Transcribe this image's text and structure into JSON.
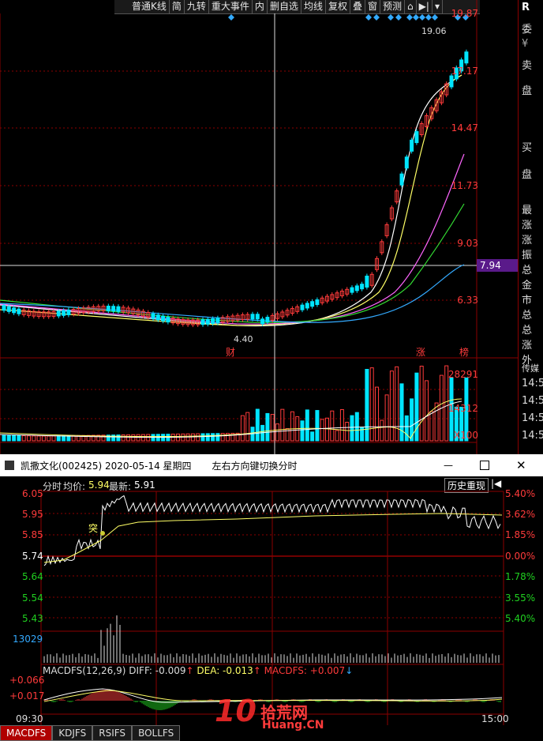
{
  "toolbar": {
    "items": [
      "普通K线",
      "简",
      "九转",
      "重大事件",
      "内",
      "删自选",
      "均线",
      "复权",
      "叠",
      "窗",
      "预测"
    ],
    "icons": [
      "home-icon",
      "export-icon",
      "dropdown-icon"
    ]
  },
  "kline": {
    "price_labels": [
      "19.87",
      "17.17",
      "14.47",
      "11.73",
      "9.03",
      "7.94",
      "6.33"
    ],
    "current_price": "7.94",
    "high_label": "19.06",
    "low_label": "4.40",
    "events": [
      "财",
      "涨",
      "榜"
    ],
    "volume_labels": [
      "28291",
      "14312",
      "X100"
    ]
  },
  "side_panel": {
    "header": "R",
    "lines": [
      "委",
      "¥",
      "卖",
      "盘",
      "",
      "买",
      "盘",
      "最",
      "涨",
      "涨",
      "振",
      "总",
      "金",
      "市",
      "总",
      "总",
      "涨",
      "外"
    ],
    "ticker": "传媒",
    "times": [
      "14:5",
      "14:5",
      "14:5",
      "14:5"
    ]
  },
  "window": {
    "title": "凯撒文化(002425) 2020-05-14 星期四",
    "hint": "左右方向键切换分时",
    "buttons": [
      "minimize-icon",
      "maximize-icon",
      "close-icon"
    ]
  },
  "intraday": {
    "label": "分时",
    "avg_label": "均价:",
    "avg_value": "5.94",
    "last_label": "最新:",
    "last_value": "5.91",
    "history_button": "历史重现",
    "price_ticks": [
      "6.05",
      "5.95",
      "5.85",
      "5.74",
      "5.64",
      "5.54",
      "5.43"
    ],
    "pct_ticks": [
      "5.40%",
      "3.62%",
      "1.85%",
      "0.00%",
      "1.78%",
      "3.55%",
      "5.40%"
    ],
    "volume_max": "13029",
    "marker": "突",
    "macd_head": "MACDFS(12,26,9)",
    "diff": "DIFF: -0.009",
    "dea": "DEA: -0.013",
    "macdfs": "MACDFS: +0.007",
    "macd_ticks": [
      "+0.066",
      "+0.017"
    ],
    "time_start": "09:30",
    "time_end": "15:00"
  },
  "tabs": [
    "MACDFS",
    "KDJFS",
    "RSIFS",
    "BOLLFS"
  ],
  "watermark": {
    "text1": "拾荒网",
    "text2": "Huang.CN",
    "num": "10"
  },
  "colors": {
    "up": "#ff3b3b",
    "down": "#00e5ff",
    "bg": "#000000",
    "accent": "#b00000"
  }
}
